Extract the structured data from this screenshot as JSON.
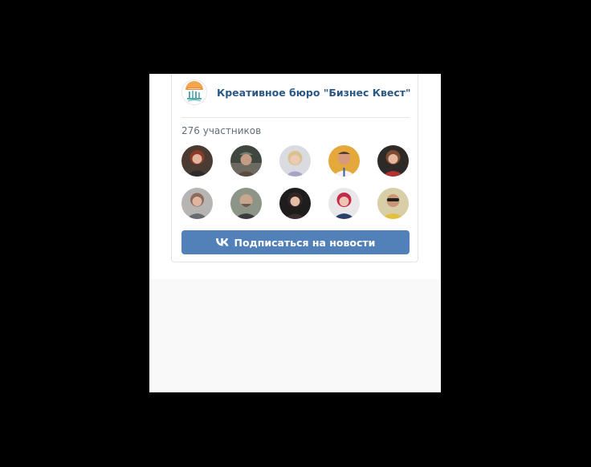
{
  "widget": {
    "group_name": "Креативное бюро \"Бизнес Квест\"",
    "members_count": "276 участников",
    "subscribe_label": "Подписаться на новости",
    "logo_icon": "business-quest-logo",
    "button_icon": "vk-logo-icon",
    "colors": {
      "accent": "#5181b8",
      "link": "#2a5885",
      "muted_text": "#626d7a",
      "divider": "#e7e8ec",
      "background": "#000000"
    },
    "members": [
      {
        "icon": "member-avatar-red-hair"
      },
      {
        "icon": "member-avatar-man-cap"
      },
      {
        "icon": "member-avatar-blonde-woman"
      },
      {
        "icon": "member-avatar-man-yellow-bg"
      },
      {
        "icon": "member-avatar-woman-red"
      },
      {
        "icon": "member-avatar-woman-gray"
      },
      {
        "icon": "member-avatar-bearded-man"
      },
      {
        "icon": "member-avatar-dark-haired-woman"
      },
      {
        "icon": "member-avatar-pink-hair-woman"
      },
      {
        "icon": "member-avatar-man-sunglasses"
      }
    ]
  }
}
